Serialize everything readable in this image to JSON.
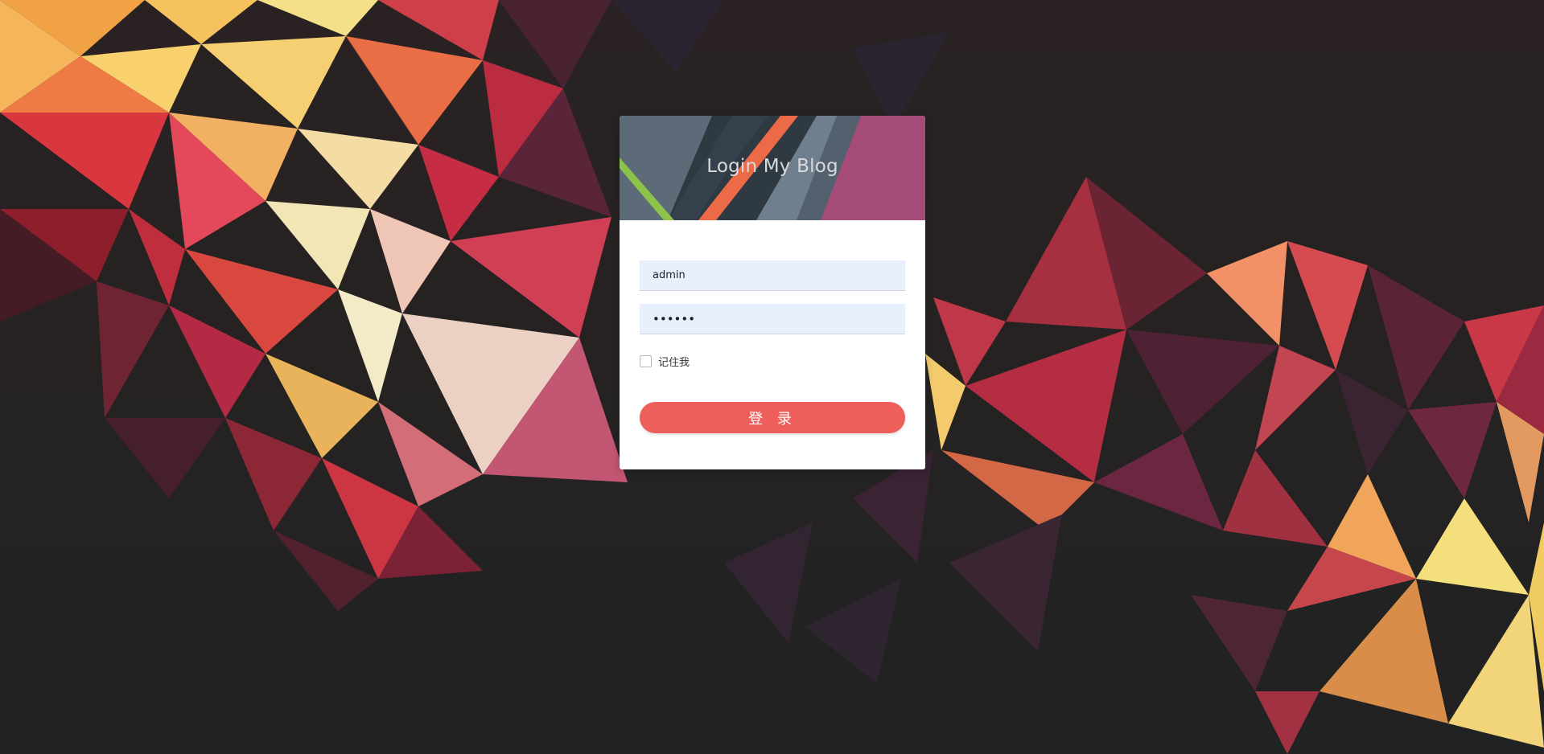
{
  "login": {
    "title": "Login My Blog",
    "username_value": "admin",
    "password_value": "••••••",
    "remember_label": "记住我",
    "submit_label": "登 录"
  },
  "colors": {
    "background": "#242525",
    "button": "#ee5f5b",
    "input_fill": "#e8f0fe",
    "card": "#ffffff"
  },
  "icons": {
    "background": "low-poly-background",
    "header": "material-header-graphic"
  }
}
